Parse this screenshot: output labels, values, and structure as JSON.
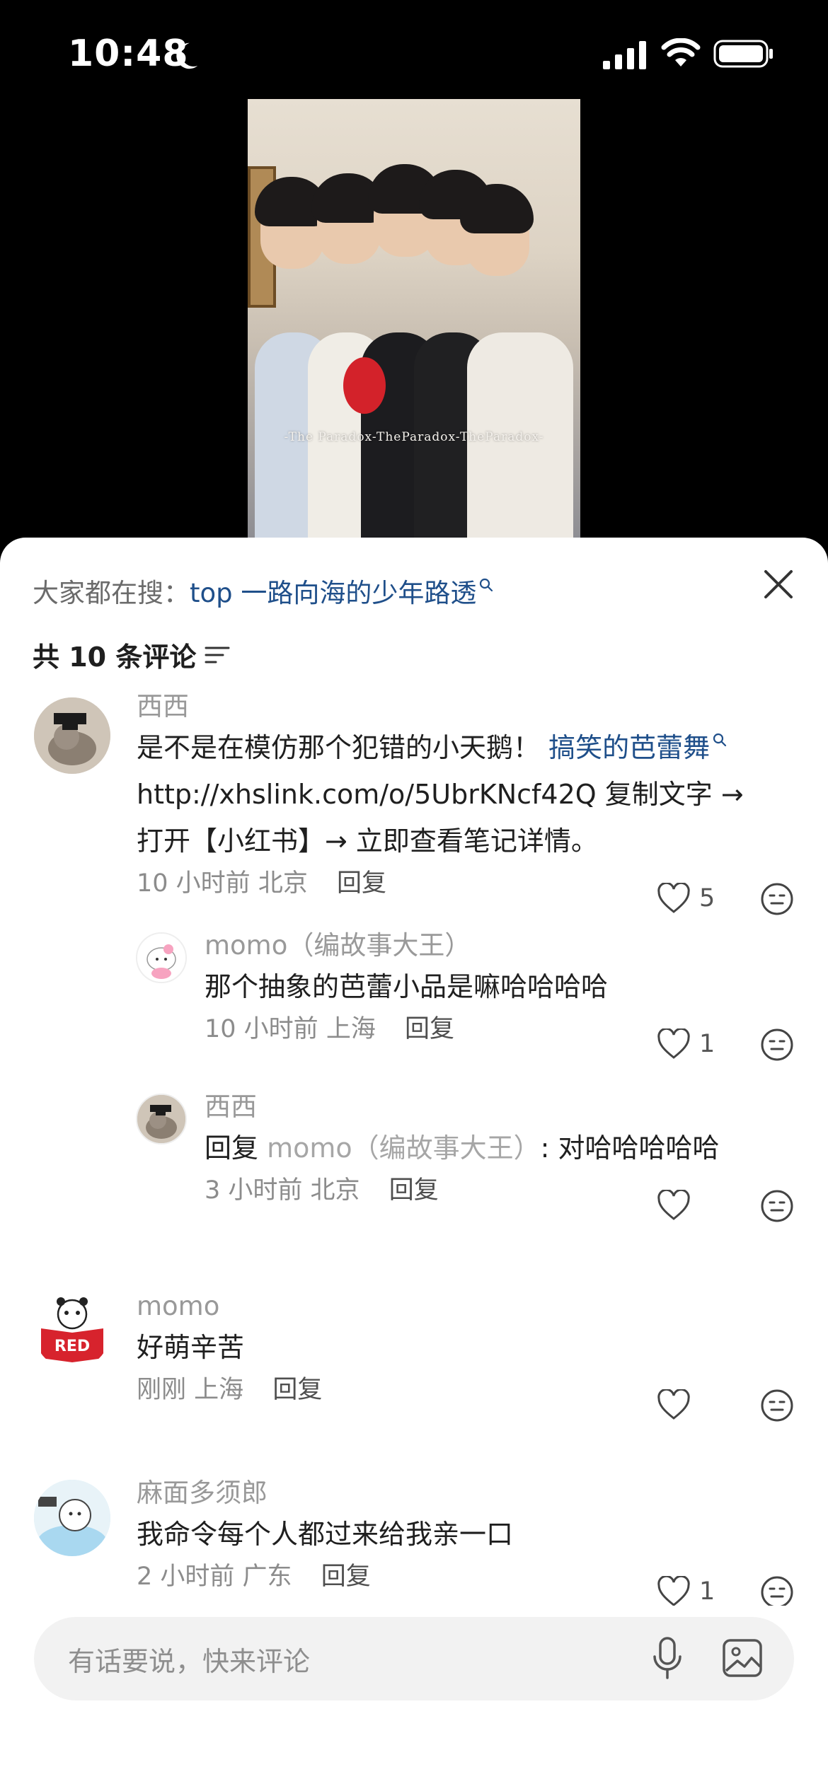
{
  "status_bar": {
    "time": "10:48"
  },
  "video": {
    "watermark": "-The Paradox-TheParadox-TheParadox-"
  },
  "search": {
    "prefix": "大家都在搜：",
    "query": "top 一路向海的少年路透"
  },
  "comments_header": {
    "count_label": "共 10 条评论"
  },
  "comments": [
    {
      "name": "西西",
      "text_before": "是不是在模仿那个犯错的小天鹅！ ",
      "link": "搞笑的芭蕾舞",
      "text_line2": "http://xhslink.com/o/5UbrKNcf42Q 复制文字 →",
      "text_line3": "打开【小红书】→ 立即查看笔记详情。",
      "time": "10 小时前",
      "location": "北京",
      "reply": "回复",
      "likes": "5"
    },
    {
      "name": "momo（编故事大王）",
      "text": "那个抽象的芭蕾小品是嘛哈哈哈哈",
      "time": "10 小时前",
      "location": "上海",
      "reply": "回复",
      "likes": "1"
    },
    {
      "name": "西西",
      "reply_prefix": "回复 ",
      "reply_to": "momo（编故事大王）",
      "text": ": 对哈哈哈哈哈",
      "time": "3 小时前",
      "location": "北京",
      "reply": "回复"
    },
    {
      "name": "momo",
      "text": "好萌辛苦",
      "time": "刚刚",
      "location": "上海",
      "reply": "回复",
      "avatar_label": "RED"
    },
    {
      "name": "麻面多须郎",
      "text": "我命令每个人都过来给我亲一口",
      "time": "2 小时前",
      "location": "广东",
      "reply": "回复",
      "likes": "1"
    }
  ],
  "input": {
    "placeholder": "有话要说，快来评论"
  },
  "colors": {
    "link": "#1f4f8a",
    "sheet_bg": "#ffffff",
    "input_bg": "#f2f2f2"
  }
}
